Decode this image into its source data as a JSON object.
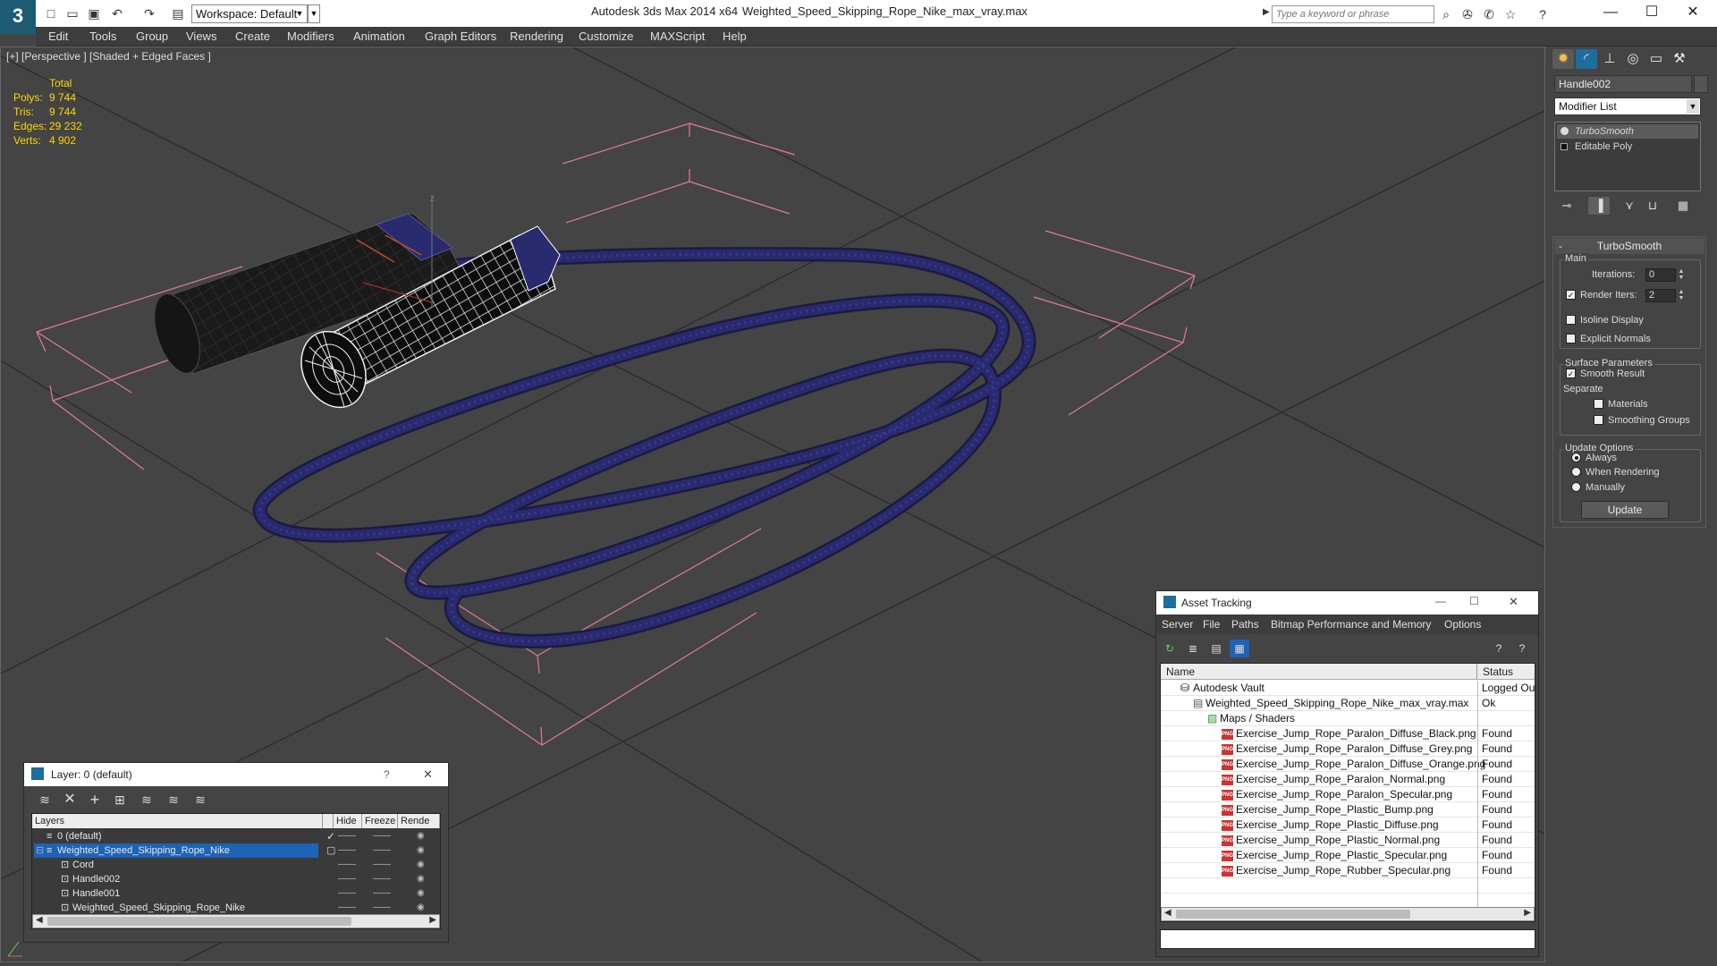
{
  "app": {
    "logo": "3",
    "workspace": "Workspace: Default",
    "title": "Autodesk 3ds Max  2014 x64",
    "file": "Weighted_Speed_Skipping_Rope_Nike_max_vray.max",
    "search_placeholder": "Type a keyword or phrase"
  },
  "menu": [
    "Edit",
    "Tools",
    "Group",
    "Views",
    "Create",
    "Modifiers",
    "Animation",
    "Graph Editors",
    "Rendering",
    "Customize",
    "MAXScript",
    "Help"
  ],
  "viewport": {
    "label": "[+] [Perspective ] [Shaded + Edged Faces ]",
    "stats": {
      "header": "Total",
      "rows": [
        {
          "k": "Polys:",
          "v": "9 744"
        },
        {
          "k": "Tris:",
          "v": "9 744"
        },
        {
          "k": "Edges:",
          "v": "29 232"
        },
        {
          "k": "Verts:",
          "v": "4 902"
        }
      ]
    },
    "axis_z": "z"
  },
  "command_panel": {
    "object_name": "Handle002",
    "modifier_list": "Modifier List",
    "stack": [
      "TurboSmooth",
      "Editable Poly"
    ],
    "rollout_title": "TurboSmooth",
    "main_label": "Main",
    "iterations_label": "Iterations:",
    "iterations_value": "0",
    "render_iters_label": "Render Iters:",
    "render_iters_value": "2",
    "isoline_label": "Isoline Display",
    "explicit_normals_label": "Explicit Normals",
    "surface_label": "Surface Parameters",
    "smooth_result_label": "Smooth Result",
    "separate_label": "Separate",
    "materials_label": "Materials",
    "smoothing_groups_label": "Smoothing Groups",
    "update_options_label": "Update Options",
    "always_label": "Always",
    "when_rendering_label": "When Rendering",
    "manually_label": "Manually",
    "update_button": "Update"
  },
  "layer_dialog": {
    "title": "Layer: 0 (default)",
    "help": "?",
    "close": "✕",
    "columns": [
      "Layers",
      "Hide",
      "Freeze",
      "Rende"
    ],
    "rows": [
      {
        "name": "0 (default)",
        "indent": 1
      },
      {
        "name": "Weighted_Speed_Skipping_Rope_Nike",
        "indent": 1
      },
      {
        "name": "Cord",
        "indent": 2
      },
      {
        "name": "Handle002",
        "indent": 2
      },
      {
        "name": "Handle001",
        "indent": 2
      },
      {
        "name": "Weighted_Speed_Skipping_Rope_Nike",
        "indent": 2
      }
    ]
  },
  "asset_tracking": {
    "title": "Asset Tracking",
    "menu": [
      "Server",
      "File",
      "Paths",
      "Bitmap Performance and Memory",
      "Options"
    ],
    "columns": [
      "Name",
      "Status"
    ],
    "rows": [
      {
        "name": "Autodesk Vault",
        "status": "Logged Out",
        "indent": 0
      },
      {
        "name": "Weighted_Speed_Skipping_Rope_Nike_max_vray.max",
        "status": "Ok",
        "indent": 1
      },
      {
        "name": "Maps / Shaders",
        "status": "",
        "indent": 2
      },
      {
        "name": "Exercise_Jump_Rope_Paralon_Diffuse_Black.png",
        "status": "Found",
        "indent": 3
      },
      {
        "name": "Exercise_Jump_Rope_Paralon_Diffuse_Grey.png",
        "status": "Found",
        "indent": 3
      },
      {
        "name": "Exercise_Jump_Rope_Paralon_Diffuse_Orange.png",
        "status": "Found",
        "indent": 3
      },
      {
        "name": "Exercise_Jump_Rope_Paralon_Normal.png",
        "status": "Found",
        "indent": 3
      },
      {
        "name": "Exercise_Jump_Rope_Paralon_Specular.png",
        "status": "Found",
        "indent": 3
      },
      {
        "name": "Exercise_Jump_Rope_Plastic_Bump.png",
        "status": "Found",
        "indent": 3
      },
      {
        "name": "Exercise_Jump_Rope_Plastic_Diffuse.png",
        "status": "Found",
        "indent": 3
      },
      {
        "name": "Exercise_Jump_Rope_Plastic_Normal.png",
        "status": "Found",
        "indent": 3
      },
      {
        "name": "Exercise_Jump_Rope_Plastic_Specular.png",
        "status": "Found",
        "indent": 3
      },
      {
        "name": "Exercise_Jump_Rope_Rubber_Specular.png",
        "status": "Found",
        "indent": 3
      }
    ]
  },
  "colors": {
    "rope": "#2a2a6e",
    "selection_box": "#e07aa0",
    "stats": "#ffd700",
    "grid": "#2e2e2e"
  }
}
